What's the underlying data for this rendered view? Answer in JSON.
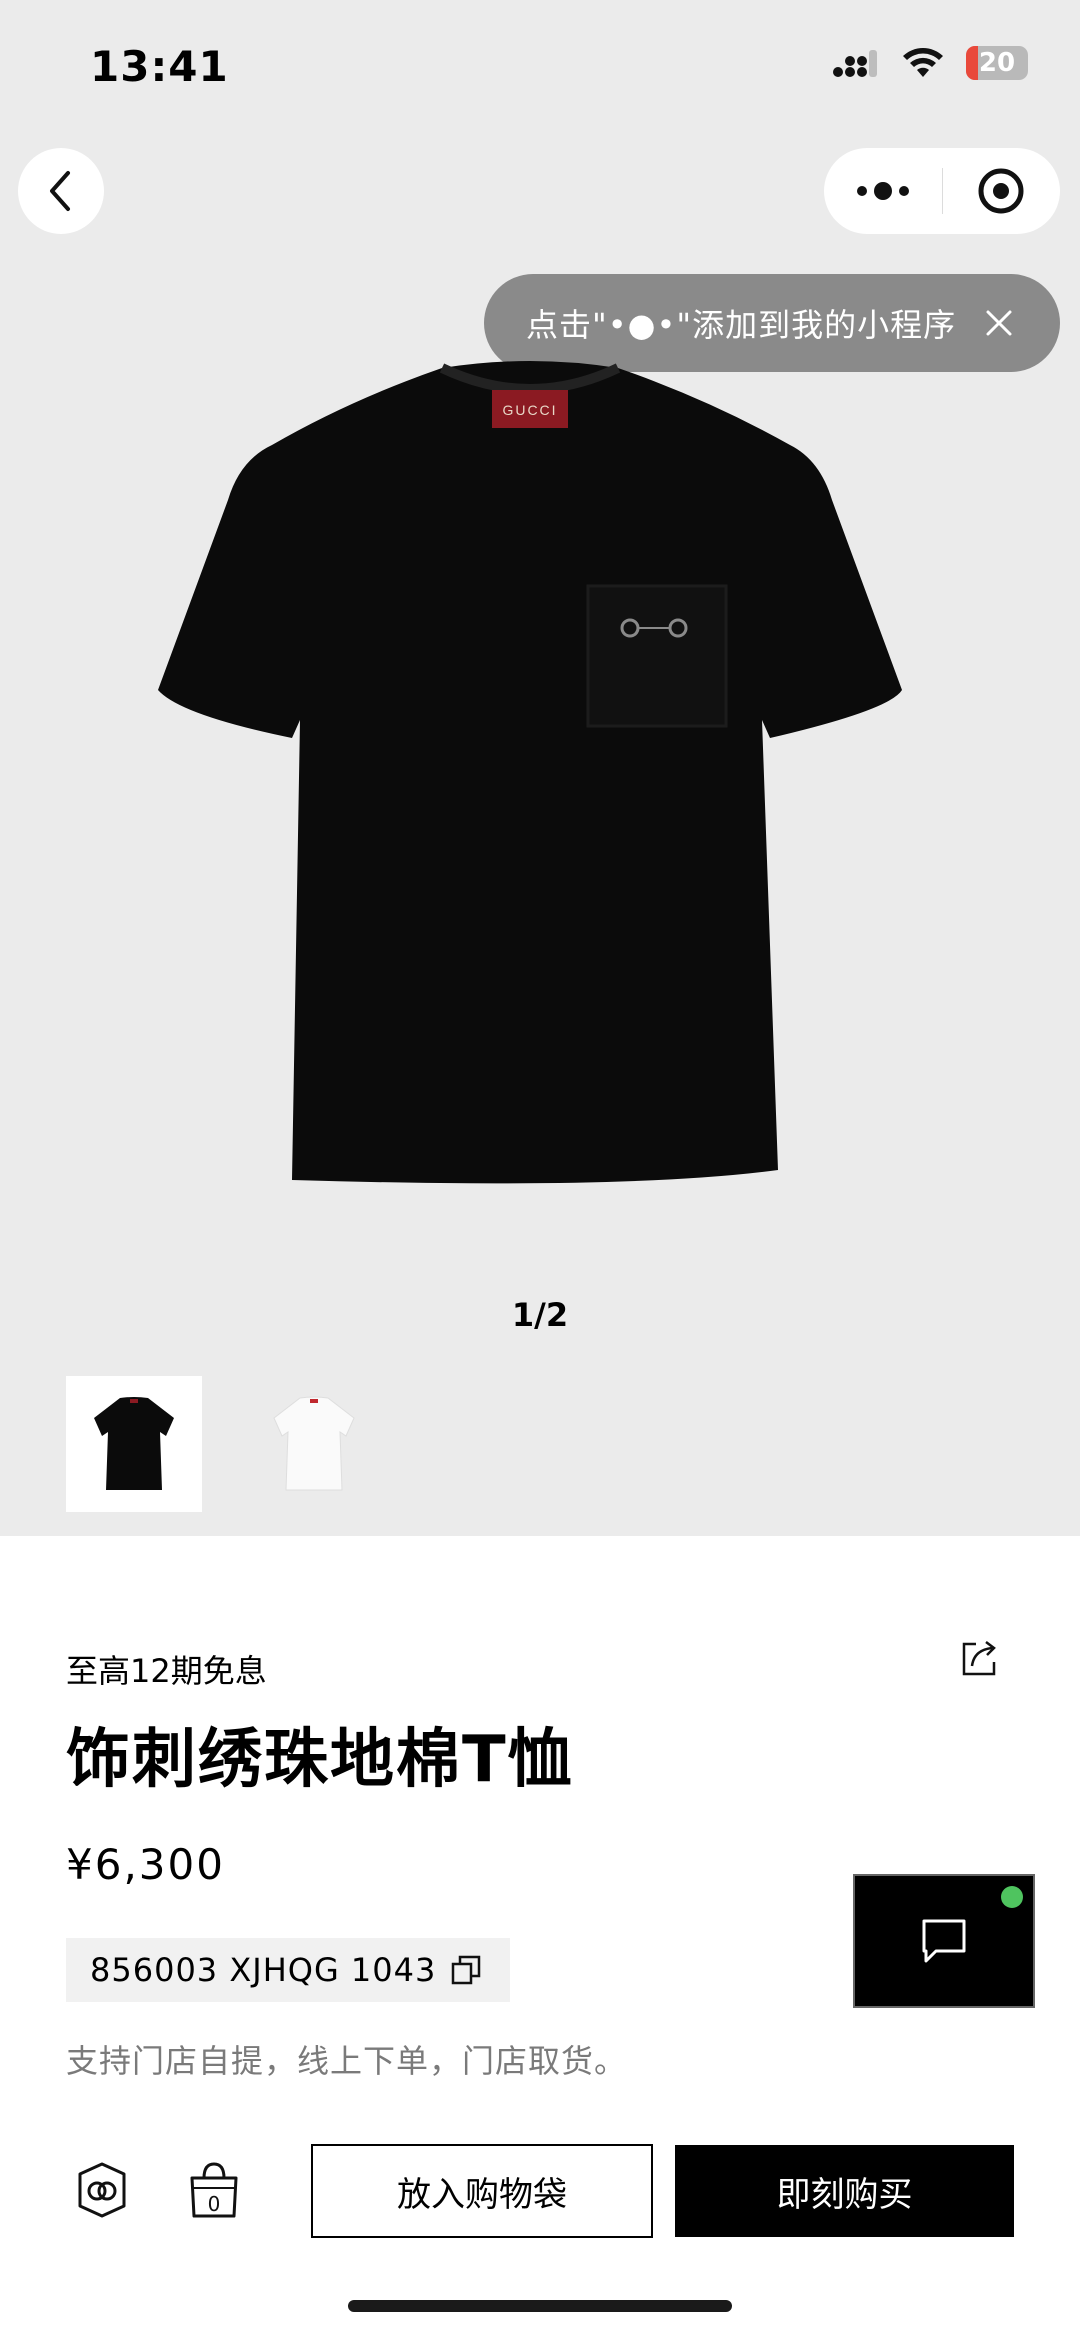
{
  "status_bar": {
    "time": "13:41",
    "battery": "20"
  },
  "toast": {
    "text": "点击\"•●•\"添加到我的小程序"
  },
  "gallery": {
    "pager": "1/2",
    "label_text": "GUCCI"
  },
  "product": {
    "interest": "至高12期免息",
    "title": "饰刺绣珠地棉T恤",
    "price": "¥6,300",
    "sku": "856003 XJHQG 1043",
    "pickup": "支持门店自提，线上下单，门店取货。"
  },
  "bottom_bar": {
    "bag_count": "0",
    "add_to_bag": "放入购物袋",
    "buy_now": "即刻购买"
  },
  "colors": {
    "accent": "#000000",
    "toast_bg": "#8a8a8a",
    "chat_dot": "#4fc45f",
    "hero_bg": "#ebebeb",
    "gucci_label": "#8b1a22"
  },
  "icons": [
    "signal-icon",
    "wifi-icon",
    "battery-icon",
    "back-icon",
    "more-dots-icon",
    "target-icon",
    "close-icon",
    "share-icon",
    "copy-icon",
    "chat-icon",
    "gucci-logo-icon",
    "bag-icon"
  ]
}
